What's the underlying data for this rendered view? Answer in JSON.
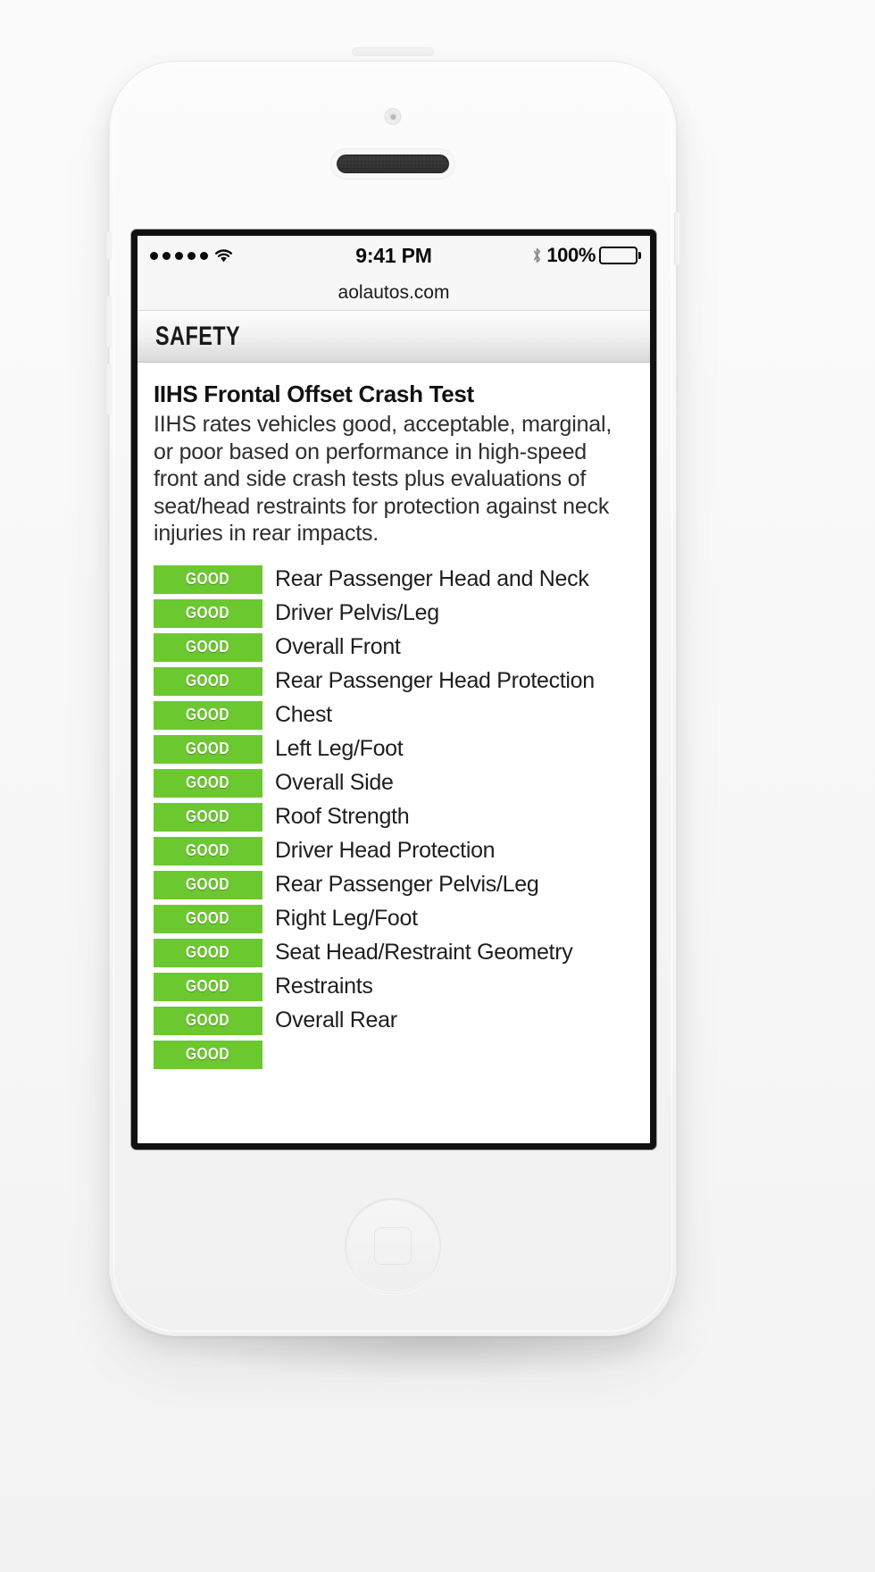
{
  "status_bar": {
    "signal_dots": 5,
    "signal_icon": "signal-dots",
    "wifi_icon": "wifi-icon",
    "time": "9:41 PM",
    "bluetooth_icon": "bluetooth-icon",
    "battery_percent": "100%",
    "battery_icon": "battery-full-icon"
  },
  "browser": {
    "url": "aolautos.com"
  },
  "section": {
    "title": "SAFETY"
  },
  "article": {
    "heading": "IIHS Frontal Offset Crash Test",
    "description": "IIHS rates vehicles good, acceptable, marginal, or poor based on performance in high-speed front and side crash tests plus evaluations of seat/head restraints for protection against neck injuries in rear impacts."
  },
  "colors": {
    "rating_good": "#6cc82f",
    "badge_text": "#ffffff",
    "header_gradient_top": "#fdfdfd",
    "header_gradient_bottom": "#d9d9d9"
  },
  "ratings": [
    {
      "rating": "GOOD",
      "label": "Rear Passenger Head and Neck"
    },
    {
      "rating": "GOOD",
      "label": "Driver Pelvis/Leg"
    },
    {
      "rating": "GOOD",
      "label": "Overall Front"
    },
    {
      "rating": "GOOD",
      "label": "Rear Passenger Head Protection"
    },
    {
      "rating": "GOOD",
      "label": "Chest"
    },
    {
      "rating": "GOOD",
      "label": "Left Leg/Foot"
    },
    {
      "rating": "GOOD",
      "label": "Overall Side"
    },
    {
      "rating": "GOOD",
      "label": "Roof Strength"
    },
    {
      "rating": "GOOD",
      "label": "Driver Head Protection"
    },
    {
      "rating": "GOOD",
      "label": "Rear Passenger Pelvis/Leg"
    },
    {
      "rating": "GOOD",
      "label": "Right Leg/Foot"
    },
    {
      "rating": "GOOD",
      "label": "Seat Head/Restraint Geometry"
    },
    {
      "rating": "GOOD",
      "label": "Restraints"
    },
    {
      "rating": "GOOD",
      "label": "Overall Rear"
    },
    {
      "rating": "GOOD",
      "label": ""
    }
  ]
}
